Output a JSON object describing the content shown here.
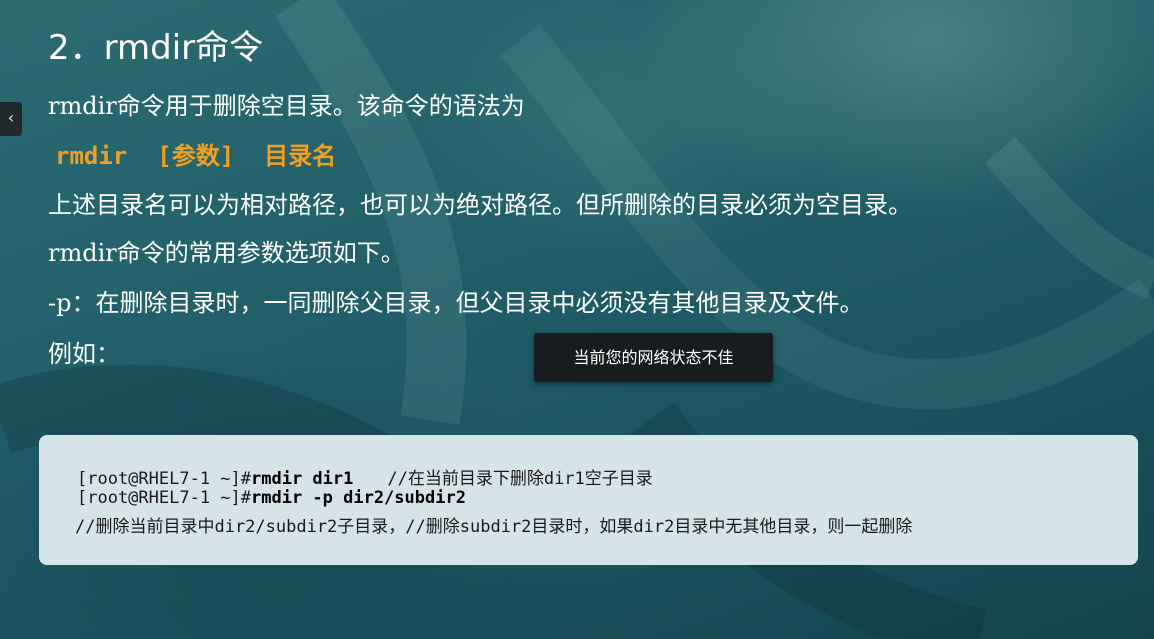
{
  "slide": {
    "title": "2．rmdir命令",
    "intro": "rmdir命令用于删除空目录。该命令的语法为",
    "syntax": {
      "command": "rmdir",
      "params": "[参数]",
      "dirname": "目录名"
    },
    "description": "上述目录名可以为相对路径，也可以为绝对路径。但所删除的目录必须为空目录。",
    "options_intro": "rmdir命令的常用参数选项如下。",
    "option_p": "-p：在删除目录时，一同删除父目录，但父目录中必须没有其他目录及文件。",
    "example_label": "例如："
  },
  "code": {
    "line1_prompt": "[root@RHEL7-1 ~]#",
    "line1_cmd": "rmdir dir1",
    "line1_comment": "//在当前目录下删除dir1空子目录",
    "line2_prompt": "[root@RHEL7-1 ~]#",
    "line2_cmd": "rmdir -p dir2/subdir2",
    "line3": "//删除当前目录中dir2/subdir2子目录，//删除subdir2目录时，如果dir2目录中无其他目录，则一起删除"
  },
  "toast": {
    "message": "当前您的网络状态不佳"
  },
  "side_tab": {
    "icon": "chevron-left-icon",
    "glyph": "‹"
  },
  "colors": {
    "background": "#22606a",
    "syntax_accent": "#f0a020",
    "code_box_bg": "#d6e4ea",
    "toast_bg": "#181c1f"
  }
}
